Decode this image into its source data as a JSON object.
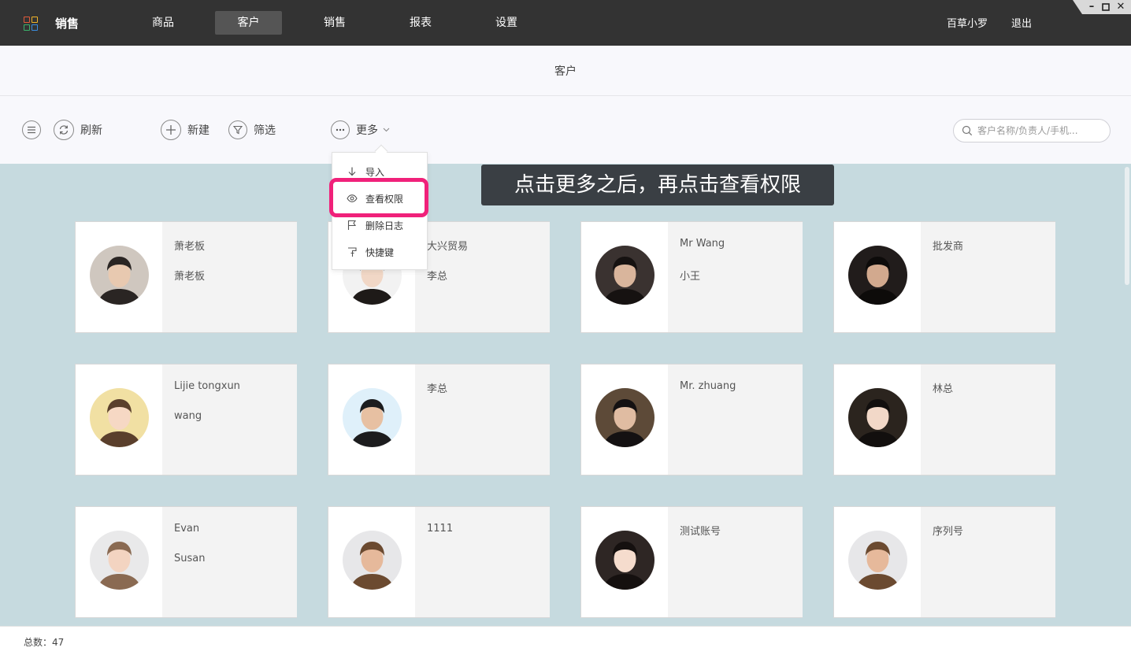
{
  "app": {
    "title": "销售"
  },
  "nav": [
    {
      "label": "商品"
    },
    {
      "label": "客户"
    },
    {
      "label": "销售"
    },
    {
      "label": "报表"
    },
    {
      "label": "设置"
    }
  ],
  "user": {
    "name": "百草小罗",
    "logout": "退出"
  },
  "page": {
    "title": "客户"
  },
  "toolbar": {
    "refresh": "刷新",
    "new": "新建",
    "filter": "筛选",
    "more": "更多",
    "search_placeholder": "客户名称/负责人/手机..."
  },
  "more_menu": [
    {
      "label": "导入",
      "icon": "arrow-down-icon"
    },
    {
      "label": "查看权限",
      "icon": "eye-icon"
    },
    {
      "label": "删除日志",
      "icon": "flag-icon"
    },
    {
      "label": "快捷键",
      "icon": "pushpin-icon"
    }
  ],
  "tooltip": "点击更多之后，再点击查看权限",
  "customers": [
    {
      "line1": "萧老板",
      "line2": "萧老板"
    },
    {
      "line1": "大兴贸易",
      "line2": "李总"
    },
    {
      "line1": "Mr Wang",
      "line2": "小王"
    },
    {
      "line1": "批发商",
      "line2": ""
    },
    {
      "line1": "Lijie tongxun",
      "line2": "wang"
    },
    {
      "line1": "李总",
      "line2": ""
    },
    {
      "line1": "Mr. zhuang",
      "line2": ""
    },
    {
      "line1": "林总",
      "line2": ""
    },
    {
      "line1": "Evan",
      "line2": "Susan"
    },
    {
      "line1": "1111",
      "line2": ""
    },
    {
      "line1": "测试账号",
      "line2": ""
    },
    {
      "line1": "序列号",
      "line2": ""
    }
  ],
  "footer": {
    "total": "总数：47"
  },
  "colors": {
    "topbar": "#333333",
    "content_bg": "#c6dadf",
    "highlight": "#f0217a",
    "tooltip_bg": "#3a3f44"
  }
}
